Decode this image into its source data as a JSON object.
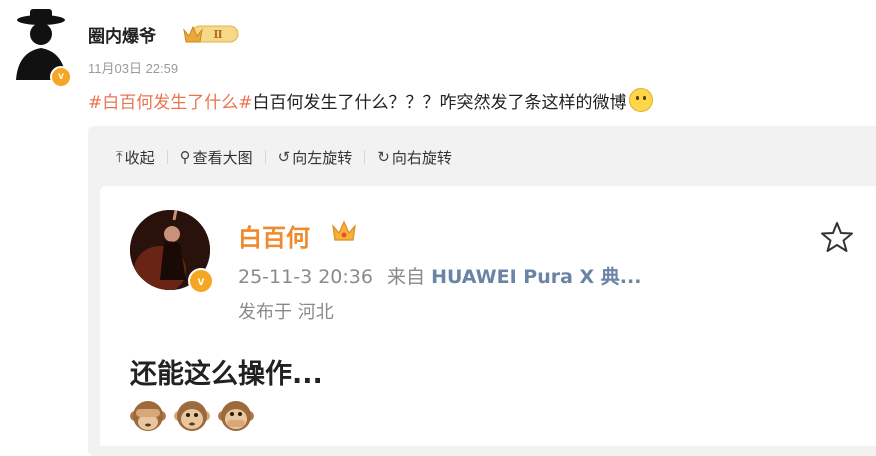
{
  "post": {
    "author_name": "圈内爆爷",
    "level_badge_text": "Ⅱ",
    "verified_mark": "v",
    "time": "11月03日 22:59",
    "hashtag": "#白百何发生了什么#",
    "text": "白百何发生了什么？？？咋突然发了条这样的微博"
  },
  "toolbar": {
    "collapse_label": "收起",
    "view_large_label": "查看大图",
    "rotate_left_label": "向左旋转",
    "rotate_right_label": "向右旋转"
  },
  "embedded": {
    "author_name": "白百何",
    "verified_mark": "v",
    "datetime": "25-11-3 20:36",
    "from_prefix": "来自",
    "source": "HUAWEI Pura X 典...",
    "location": "发布于 河北",
    "text": "还能这么操作...",
    "emojis": [
      "see-no-evil-monkey",
      "hear-no-evil-monkey",
      "speak-no-evil-monkey"
    ]
  },
  "colors": {
    "hashtag": "#eb7350",
    "embedded_name": "#f08a2c",
    "verified_badge": "#f5a623"
  }
}
